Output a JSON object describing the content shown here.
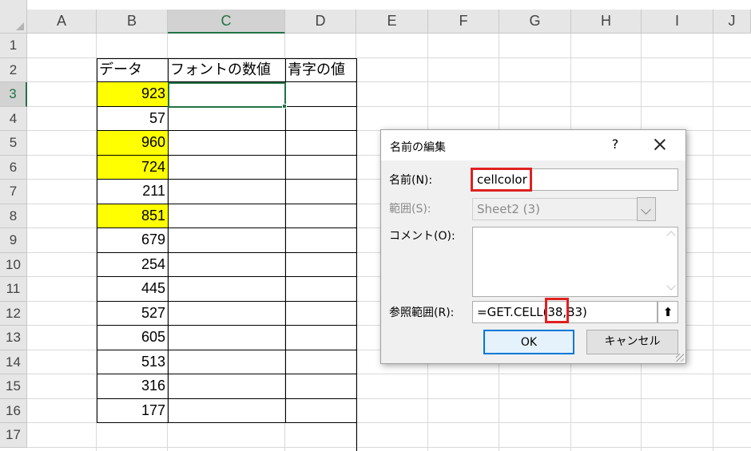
{
  "columns": [
    "A",
    "B",
    "C",
    "D",
    "E",
    "F",
    "G",
    "H",
    "I",
    "J"
  ],
  "active_column": "C",
  "rows": [
    "1",
    "2",
    "3",
    "4",
    "5",
    "6",
    "7",
    "8",
    "9",
    "10",
    "11",
    "12",
    "13",
    "14",
    "15",
    "16",
    "17"
  ],
  "active_row": "3",
  "table": {
    "headers": [
      "データ",
      "フォントの数値",
      "青字の値"
    ],
    "data": [
      {
        "value": "923",
        "highlight": true
      },
      {
        "value": "57",
        "highlight": false
      },
      {
        "value": "960",
        "highlight": true
      },
      {
        "value": "724",
        "highlight": true
      },
      {
        "value": "211",
        "highlight": false
      },
      {
        "value": "851",
        "highlight": true
      },
      {
        "value": "679",
        "highlight": false
      },
      {
        "value": "254",
        "highlight": false
      },
      {
        "value": "445",
        "highlight": false
      },
      {
        "value": "527",
        "highlight": false
      },
      {
        "value": "605",
        "highlight": false
      },
      {
        "value": "513",
        "highlight": false
      },
      {
        "value": "316",
        "highlight": false
      },
      {
        "value": "177",
        "highlight": false
      }
    ]
  },
  "colors": {
    "highlight": "#ffff00",
    "accent": "#217346",
    "annotation": "#e02020"
  },
  "dialog": {
    "title": "名前の編集",
    "help_label": "?",
    "name_label": "名前(N):",
    "name_value": "cellcolor",
    "scope_label": "範囲(S):",
    "scope_value": "Sheet2 (3)",
    "comment_label": "コメント(O):",
    "comment_value": "",
    "ref_label": "参照範囲(R):",
    "ref_value": "=GET.CELL(38,B3)",
    "ref_button_glyph": "⬆",
    "ok_label": "OK",
    "cancel_label": "キャンセル"
  }
}
